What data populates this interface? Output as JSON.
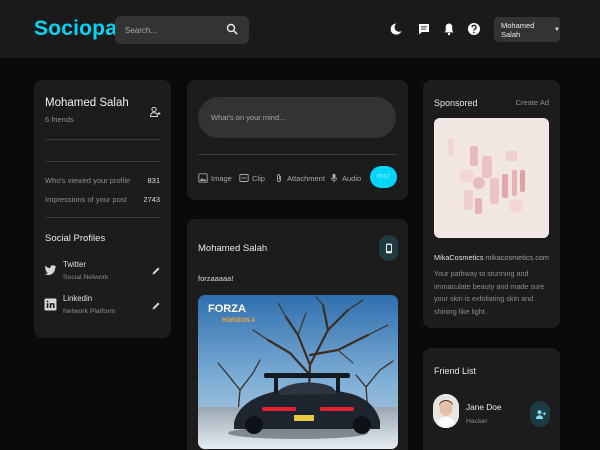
{
  "app": {
    "name": "Sociopath"
  },
  "search": {
    "placeholder": "Search..."
  },
  "nav": {
    "icons": [
      "moon-icon",
      "message-icon",
      "bell-icon",
      "help-icon"
    ],
    "user_menu_label": "Mohamed Salah"
  },
  "profile": {
    "name": "Mohamed Salah",
    "friends": "6 friends",
    "stats": [
      {
        "label": "Who's viewed your profile",
        "value": "831"
      },
      {
        "label": "Impressions of your post",
        "value": "2743"
      }
    ],
    "social_title": "Social Profiles",
    "socials": [
      {
        "name": "Twitter",
        "type": "Social Network"
      },
      {
        "name": "Linkedin",
        "type": "Network Platform"
      }
    ]
  },
  "composer": {
    "placeholder": "What's on your mind...",
    "tools": [
      "Image",
      "Clip",
      "Attachment",
      "Audio"
    ],
    "post_label": "POST"
  },
  "feed_post": {
    "author": "Mohamed Salah",
    "text": "forzaaaaa!",
    "image_logo_top": "FORZA",
    "image_logo_bottom": "HORIZON 4"
  },
  "sponsored": {
    "title": "Sponsored",
    "create_ad": "Create Ad",
    "brand": "MikaCosmetics",
    "url": "mikacosmetics.com",
    "description": "Your pathway to stunning and immaculate beauty and made sure your skin is exfoliating skin and shining like light."
  },
  "friend_list": {
    "title": "Friend List",
    "friends": [
      {
        "name": "Jane Doe",
        "role": "Hacker"
      }
    ]
  },
  "colors": {
    "accent": "#00d5fa",
    "background": "#0a0a0a",
    "card": "#1c1c1c",
    "topbar": "#1a1a1a",
    "input": "#333333"
  }
}
